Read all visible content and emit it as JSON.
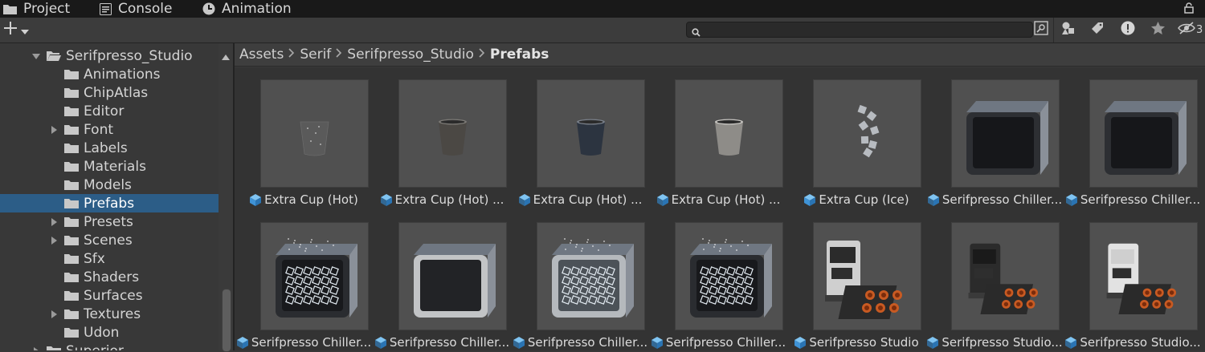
{
  "tabs": [
    {
      "label": "Project",
      "icon": "folder-icon"
    },
    {
      "label": "Console",
      "icon": "console-icon"
    },
    {
      "label": "Animation",
      "icon": "clock-icon"
    }
  ],
  "toolbar": {
    "search_placeholder": "",
    "hidden_count": "3"
  },
  "tree": {
    "items": [
      {
        "label": "Serifpresso_Studio",
        "depth": 1,
        "expanded": true,
        "hasArrow": true,
        "selected": false
      },
      {
        "label": "Animations",
        "depth": 2,
        "hasArrow": false,
        "selected": false
      },
      {
        "label": "ChipAtlas",
        "depth": 2,
        "hasArrow": false,
        "selected": false
      },
      {
        "label": "Editor",
        "depth": 2,
        "hasArrow": false,
        "selected": false
      },
      {
        "label": "Font",
        "depth": 2,
        "hasArrow": true,
        "selected": false
      },
      {
        "label": "Labels",
        "depth": 2,
        "hasArrow": false,
        "selected": false
      },
      {
        "label": "Materials",
        "depth": 2,
        "hasArrow": false,
        "selected": false
      },
      {
        "label": "Models",
        "depth": 2,
        "hasArrow": false,
        "selected": false
      },
      {
        "label": "Prefabs",
        "depth": 2,
        "hasArrow": false,
        "selected": true
      },
      {
        "label": "Presets",
        "depth": 2,
        "hasArrow": true,
        "selected": false
      },
      {
        "label": "Scenes",
        "depth": 2,
        "hasArrow": true,
        "selected": false
      },
      {
        "label": "Sfx",
        "depth": 2,
        "hasArrow": false,
        "selected": false
      },
      {
        "label": "Shaders",
        "depth": 2,
        "hasArrow": false,
        "selected": false
      },
      {
        "label": "Surfaces",
        "depth": 2,
        "hasArrow": false,
        "selected": false
      },
      {
        "label": "Textures",
        "depth": 2,
        "hasArrow": true,
        "selected": false
      },
      {
        "label": "Udon",
        "depth": 2,
        "hasArrow": false,
        "selected": false
      },
      {
        "label": "Superior",
        "depth": 1,
        "hasArrow": true,
        "selected": false
      }
    ]
  },
  "breadcrumb": [
    "Assets",
    "Serif",
    "Serifpresso_Studio",
    "Prefabs"
  ],
  "assets": [
    {
      "label": "Extra Cup (Hot)",
      "kind": "cup-clear",
      "variant": false
    },
    {
      "label": "Extra Cup (Hot) ...",
      "kind": "cup-dark",
      "variant": true
    },
    {
      "label": "Extra Cup (Hot) ...",
      "kind": "cup-navy",
      "variant": true
    },
    {
      "label": "Extra Cup (Hot) ...",
      "kind": "cup-gray",
      "variant": true
    },
    {
      "label": "Extra Cup (Ice)",
      "kind": "ice",
      "variant": false
    },
    {
      "label": "Serifpresso Chiller...",
      "kind": "chiller-empty",
      "variant": true
    },
    {
      "label": "Serifpresso Chiller...",
      "kind": "chiller-empty",
      "variant": true
    },
    {
      "label": "Serifpresso Chiller...",
      "kind": "chiller-ice-dark",
      "variant": true
    },
    {
      "label": "Serifpresso Chiller...",
      "kind": "chiller-white",
      "variant": true
    },
    {
      "label": "Serifpresso Chiller...",
      "kind": "chiller-ice-light",
      "variant": true
    },
    {
      "label": "Serifpresso Chiller...",
      "kind": "chiller-ice-dark",
      "variant": true
    },
    {
      "label": "Serifpresso Studio",
      "kind": "machine-big",
      "variant": false
    },
    {
      "label": "Serifpresso Studio...",
      "kind": "machine-dark",
      "variant": true
    },
    {
      "label": "Serifpresso Studio...",
      "kind": "machine-white",
      "variant": true
    }
  ],
  "colors": {
    "selection": "#2c5d87",
    "prefab_cube": "#4aa6e8"
  }
}
